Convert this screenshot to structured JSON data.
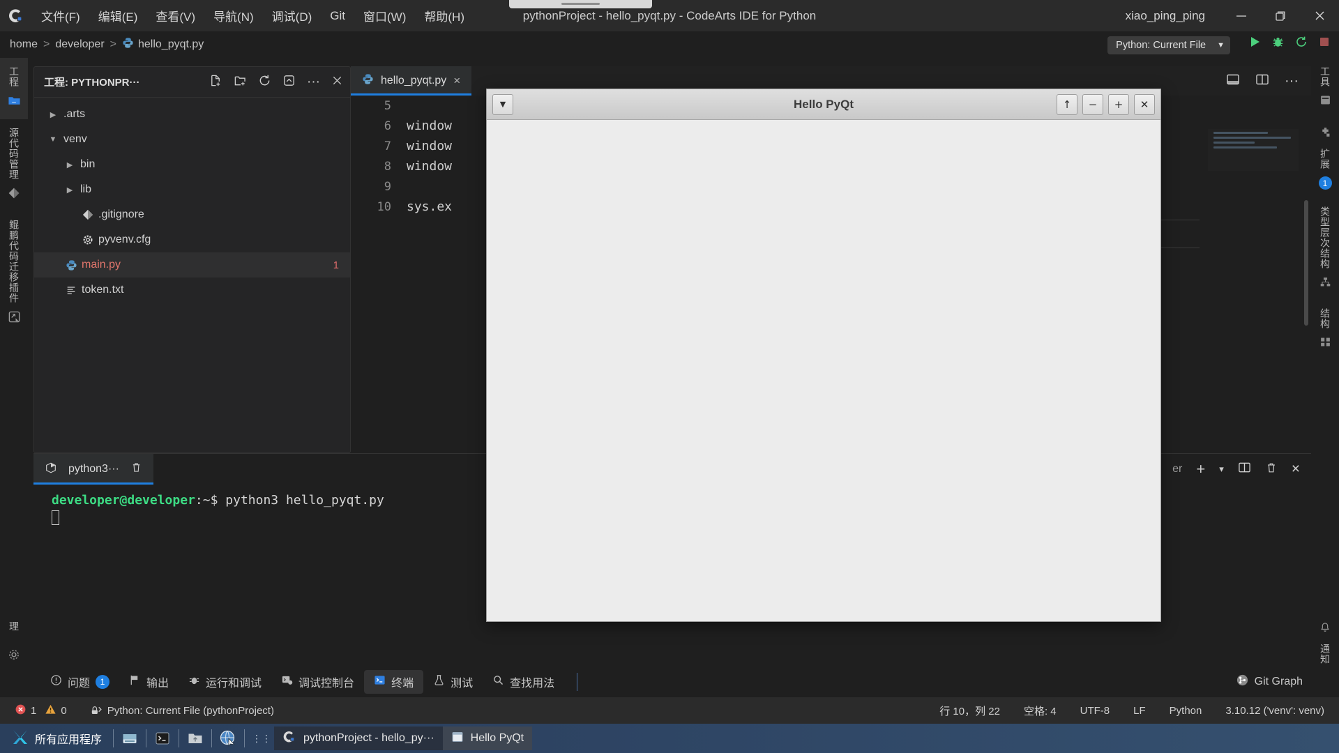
{
  "titlebar": {
    "logo_icon": "codearts-logo-icon",
    "menus": [
      "文件(F)",
      "编辑(E)",
      "查看(V)",
      "导航(N)",
      "调试(D)",
      "Git",
      "窗口(W)",
      "帮助(H)"
    ],
    "window_title": "pythonProject - hello_pyqt.py - CodeArts IDE for Python",
    "user": "xiao_ping_ping",
    "minimize": "−",
    "maximize": "restore-icon",
    "close": "×"
  },
  "breadcrumb": {
    "parts": [
      "home",
      "developer"
    ],
    "file": "hello_pyqt.py",
    "separator": ">"
  },
  "runbar": {
    "config_label": "Python: Current File",
    "config_caret": "▼",
    "run_icon": "run-play-icon",
    "debug_icon": "debug-bug-icon",
    "rerun_icon": "rerun-icon",
    "stop_icon": "stop-icon"
  },
  "activity_left": {
    "items": [
      {
        "label": "工程",
        "icon": "folder-icon",
        "active": true
      },
      {
        "label": "源代码管理",
        "icon": "source-control-icon",
        "active": false
      },
      {
        "label": "鲲鹏代码迁移插件",
        "icon": "migration-plugin-icon",
        "active": false
      }
    ],
    "bottom": [
      {
        "label": "理",
        "icon": "manage-icon",
        "active": false
      },
      {
        "label": "",
        "icon": "gear-icon",
        "active": false
      }
    ]
  },
  "activity_right": {
    "items": [
      {
        "label": "工具",
        "icon": "tools-icon",
        "badge": ""
      },
      {
        "label": "扩展",
        "icon": "extensions-icon",
        "badge": "1"
      },
      {
        "label": "类型层次结构",
        "icon": "type-hierarchy-icon",
        "badge": ""
      },
      {
        "label": "结构",
        "icon": "structure-icon",
        "badge": ""
      }
    ],
    "bottom": [
      {
        "label": "通知",
        "icon": "bell-icon",
        "badge": ""
      }
    ]
  },
  "explorer": {
    "title": "工程: PYTHONPR···",
    "actions": [
      {
        "icon": "new-file-icon"
      },
      {
        "icon": "new-folder-icon"
      },
      {
        "icon": "refresh-icon"
      },
      {
        "icon": "collapse-all-icon"
      },
      {
        "icon": "more-icon"
      },
      {
        "icon": "close-icon"
      }
    ],
    "tree": [
      {
        "label": ".arts",
        "indent": 0,
        "twist": "▶",
        "icon": "",
        "badge": "",
        "selected": false,
        "error": false
      },
      {
        "label": "venv",
        "indent": 0,
        "twist": "▼",
        "icon": "",
        "badge": "",
        "selected": false,
        "error": false
      },
      {
        "label": "bin",
        "indent": 1,
        "twist": "▶",
        "icon": "",
        "badge": "",
        "selected": false,
        "error": false
      },
      {
        "label": "lib",
        "indent": 1,
        "twist": "▶",
        "icon": "",
        "badge": "",
        "selected": false,
        "error": false
      },
      {
        "label": ".gitignore",
        "indent": 1,
        "twist": "",
        "icon": "git-icon",
        "badge": "",
        "selected": false,
        "error": false
      },
      {
        "label": "pyvenv.cfg",
        "indent": 1,
        "twist": "",
        "icon": "gear-icon",
        "badge": "",
        "selected": false,
        "error": false
      },
      {
        "label": "main.py",
        "indent": 0,
        "twist": "",
        "icon": "python-icon",
        "badge": "1",
        "selected": true,
        "error": true
      },
      {
        "label": "token.txt",
        "indent": 0,
        "twist": "",
        "icon": "text-file-icon",
        "badge": "",
        "selected": false,
        "error": false
      }
    ]
  },
  "editor": {
    "tabs": [
      {
        "label": "hello_pyqt.py",
        "icon": "python-icon",
        "close": "×",
        "active": true
      }
    ],
    "tab_actions": [
      {
        "icon": "layout-panel-icon"
      },
      {
        "icon": "split-editor-icon"
      },
      {
        "icon": "more-icon"
      }
    ],
    "lines": [
      {
        "no": "5",
        "text": ""
      },
      {
        "no": "6",
        "text": "window"
      },
      {
        "no": "7",
        "text": "window"
      },
      {
        "no": "8",
        "text": "window"
      },
      {
        "no": "9",
        "text": ""
      },
      {
        "no": "10",
        "text": "sys.ex",
        "selected": true
      }
    ]
  },
  "panel": {
    "terminal_tab": {
      "label": "python3···",
      "icon": "terminal-cube-icon",
      "trash_icon": "trash-icon"
    },
    "right_actions": [
      {
        "label": "er",
        "icon": ""
      },
      {
        "icon": "add-icon",
        "label": "+"
      },
      {
        "icon": "chevron-down-icon",
        "label": "▾"
      },
      {
        "icon": "split-terminal-icon",
        "label": ""
      },
      {
        "icon": "trash-icon",
        "label": ""
      },
      {
        "icon": "close-icon",
        "label": "×"
      }
    ],
    "terminal": {
      "prompt_user": "developer@developer",
      "prompt_path": ":~$",
      "command": "python3 hello_pyqt.py"
    }
  },
  "pyqt_window": {
    "title": "Hello PyQt",
    "menu_btn": "▼",
    "buttons": [
      {
        "glyph": "↑",
        "name": "shade-button"
      },
      {
        "glyph": "−",
        "name": "minimize-button"
      },
      {
        "glyph": "+",
        "name": "maximize-button"
      },
      {
        "glyph": "✕",
        "name": "close-button"
      }
    ]
  },
  "tool_tabs": {
    "items": [
      {
        "label": "问题",
        "icon": "problems-icon",
        "badge": "1",
        "active": false
      },
      {
        "label": "输出",
        "icon": "output-icon",
        "badge": "",
        "active": false
      },
      {
        "label": "运行和调试",
        "icon": "run-debug-icon",
        "badge": "",
        "active": false
      },
      {
        "label": "调试控制台",
        "icon": "debug-console-icon",
        "badge": "",
        "active": false
      },
      {
        "label": "终端",
        "icon": "terminal-icon",
        "badge": "",
        "active": true
      },
      {
        "label": "测试",
        "icon": "test-flask-icon",
        "badge": "",
        "active": false
      },
      {
        "label": "查找用法",
        "icon": "search-usages-icon",
        "badge": "",
        "active": false
      }
    ],
    "right": {
      "label": "Git Graph",
      "icon": "git-graph-icon"
    }
  },
  "statusbar": {
    "errors": "1",
    "warnings": "0",
    "error_icon": "error-circle-icon",
    "warning_icon": "warning-triangle-icon",
    "run_config_icon": "run-config-icon",
    "run_config": "Python: Current File (pythonProject)",
    "right": [
      {
        "label": "行 10，列 22",
        "name": "cursor-position"
      },
      {
        "label": "空格: 4",
        "name": "indentation"
      },
      {
        "label": "UTF-8",
        "name": "encoding"
      },
      {
        "label": "LF",
        "name": "line-ending"
      },
      {
        "label": "Python",
        "name": "language-mode"
      },
      {
        "label": "3.10.12 ('venv': venv)",
        "name": "python-interpreter"
      }
    ]
  },
  "taskbar": {
    "start_label": "所有应用程序",
    "start_icon": "x-logo-icon",
    "launchers": [
      {
        "icon": "files-icon",
        "name": "launcher-filemanager"
      },
      {
        "icon": "terminal-icon",
        "name": "launcher-terminal"
      },
      {
        "icon": "folder-icon",
        "name": "launcher-folder"
      },
      {
        "icon": "browser-globe-icon",
        "name": "launcher-browser"
      }
    ],
    "windows": [
      {
        "label": "pythonProject - hello_py···",
        "icon": "codearts-logo-icon",
        "active": false
      },
      {
        "label": "Hello PyQt",
        "icon": "window-icon",
        "active": true
      }
    ]
  },
  "colors": {
    "accent_blue": "#1f7fe0",
    "error_red": "#e2766c",
    "terminal_green": "#3ddc84",
    "run_green": "#4cd07d",
    "bg_dark": "#1f1f1f",
    "titlebar": "#2b2b2b"
  }
}
